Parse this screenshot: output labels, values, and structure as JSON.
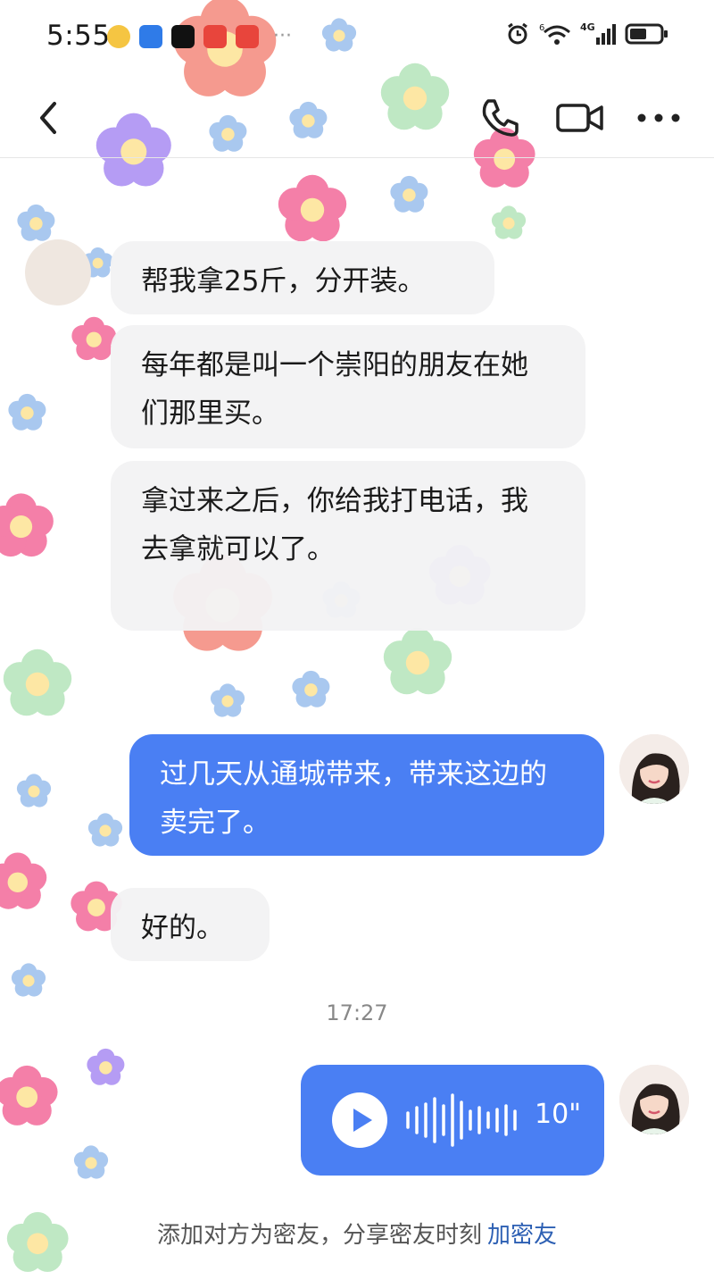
{
  "status_bar": {
    "time": "5:55",
    "app_icons": [
      "emoji-app-icon",
      "phone-manager-icon",
      "tiktok-icon",
      "huawei-app-icon",
      "huawei-mall-icon"
    ],
    "more": "···",
    "signal_text": "4G",
    "wifi_label": "6"
  },
  "header": {
    "back_icon": "chevron-left-icon",
    "call_icon": "phone-icon",
    "video_icon": "video-camera-icon",
    "more_icon": "more-horizontal-icon"
  },
  "messages": [
    {
      "direction": "in",
      "text": "帮我拿25斤，分开装。"
    },
    {
      "direction": "in",
      "text": "每年都是叫一个崇阳的朋友在她们那里买。"
    },
    {
      "direction": "in",
      "text": "拿过来之后，你给我打电话，我去拿就可以了。"
    },
    {
      "direction": "out",
      "text": "过几天从通城带来，带来这边的卖完了。"
    },
    {
      "direction": "in",
      "text": "好的。"
    }
  ],
  "timestamp": "17:27",
  "voice_message": {
    "duration": "10\"",
    "play_icon": "play-icon",
    "waveform_icon": "waveform-icon"
  },
  "bottom": {
    "prompt": "添加对方为密友，分享密友时刻",
    "action": "加密友"
  },
  "colors": {
    "outgoing_bubble": "#4a7ff3",
    "incoming_bubble": "#f2f2f4",
    "link": "#2c5fb3"
  }
}
